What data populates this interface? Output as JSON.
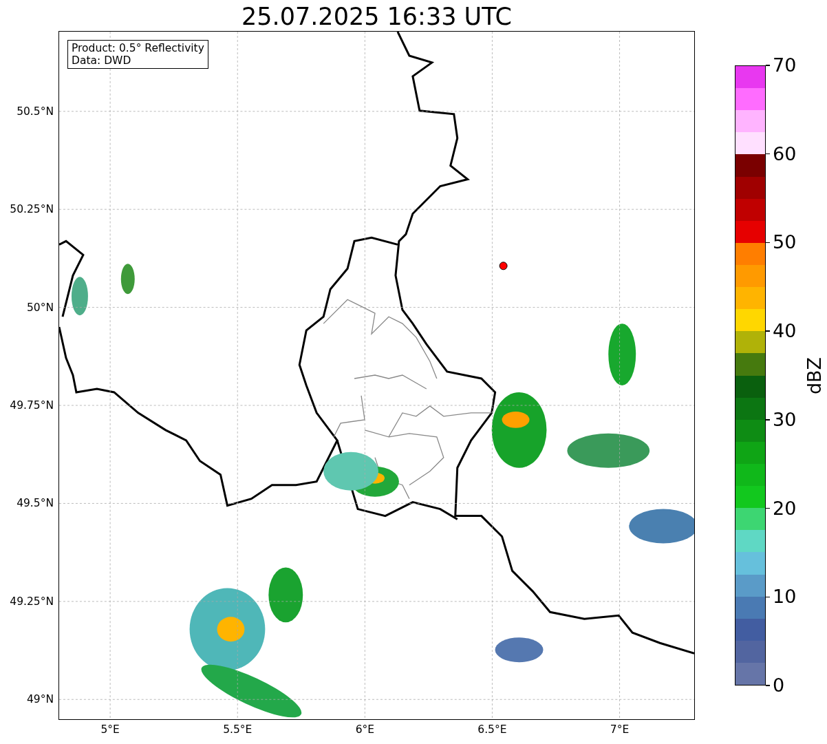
{
  "title": "25.07.2025 16:33 UTC",
  "legend": [
    "Product: 0.5° Reflectivity",
    "Data: DWD"
  ],
  "map": {
    "ytick_labels": [
      "50.5°N",
      "50.25°N",
      "50°N",
      "49.75°N",
      "49.5°N",
      "49.25°N",
      "49°N"
    ],
    "xtick_labels": [
      "5°E",
      "5.5°E",
      "6°E",
      "6.5°E",
      "7°E"
    ]
  },
  "colorbar": {
    "label": "dBZ",
    "ticks": [
      "70",
      "60",
      "50",
      "40",
      "30",
      "20",
      "10",
      "0"
    ],
    "segments": [
      {
        "color": "#e838f0"
      },
      {
        "color": "#ff6cff"
      },
      {
        "color": "#ffb4ff"
      },
      {
        "color": "#ffe0ff"
      },
      {
        "color": "#7a0000"
      },
      {
        "color": "#a00000"
      },
      {
        "color": "#c00000"
      },
      {
        "color": "#e60000"
      },
      {
        "color": "#ff7e00"
      },
      {
        "color": "#ff9a00"
      },
      {
        "color": "#ffb400"
      },
      {
        "color": "#ffd700"
      },
      {
        "color": "#b0b208"
      },
      {
        "color": "#467a0e"
      },
      {
        "color": "#0a600e"
      },
      {
        "color": "#0c7612"
      },
      {
        "color": "#0e8c14"
      },
      {
        "color": "#0fa515"
      },
      {
        "color": "#10b81a"
      },
      {
        "color": "#12c81e"
      },
      {
        "color": "#3dd672"
      },
      {
        "color": "#5fd8c4"
      },
      {
        "color": "#66c0dc"
      },
      {
        "color": "#5a9bc8"
      },
      {
        "color": "#4a7ab3"
      },
      {
        "color": "#425da1"
      },
      {
        "color": "#5265a0"
      },
      {
        "color": "#6675a8"
      }
    ]
  }
}
